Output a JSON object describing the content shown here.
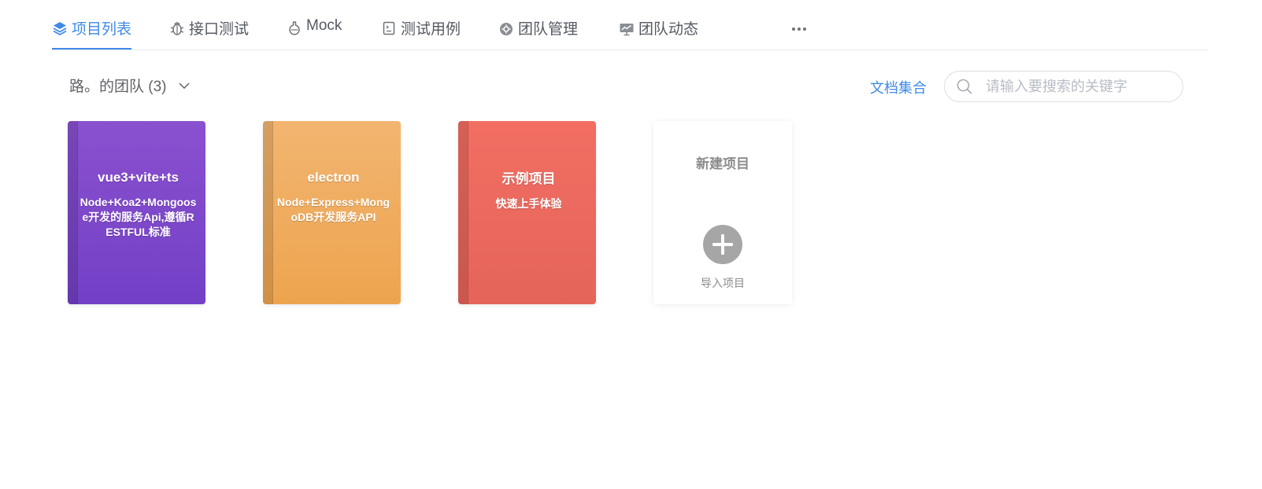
{
  "tabs": [
    {
      "label": "项目列表",
      "icon": "layers-icon",
      "active": true
    },
    {
      "label": "接口测试",
      "icon": "bug-icon",
      "active": false
    },
    {
      "label": "Mock",
      "icon": "flask-icon",
      "active": false
    },
    {
      "label": "测试用例",
      "icon": "document-list-icon",
      "active": false
    },
    {
      "label": "团队管理",
      "icon": "team-gear-icon",
      "active": false
    },
    {
      "label": "团队动态",
      "icon": "monitor-activity-icon",
      "active": false
    }
  ],
  "more_icon": "more-dots-icon",
  "team_selector": {
    "label": "路。的团队 (3)",
    "icon": "chevron-down-icon"
  },
  "docs_link": "文档集合",
  "search": {
    "placeholder": "请输入要搜索的关键字",
    "value": "",
    "icon": "search-icon"
  },
  "projects": [
    {
      "title": "vue3+vite+ts",
      "description": "Node+Koa2+Mongoose开发的服务Api,遵循RESTFUL标准",
      "color": "#8a51cf"
    },
    {
      "title": "electron",
      "description": "Node+Express+MongoDB开发服务API",
      "color": "#f0ad5e"
    },
    {
      "title": "示例项目",
      "description": "快速上手体验",
      "color": "#ee6a5f"
    }
  ],
  "new_project": {
    "title": "新建项目",
    "import_label": "导入项目",
    "icon": "plus-circle-icon"
  },
  "colors": {
    "accent": "#3f8ae6",
    "text": "#555a61",
    "muted": "#8c8c8c"
  }
}
